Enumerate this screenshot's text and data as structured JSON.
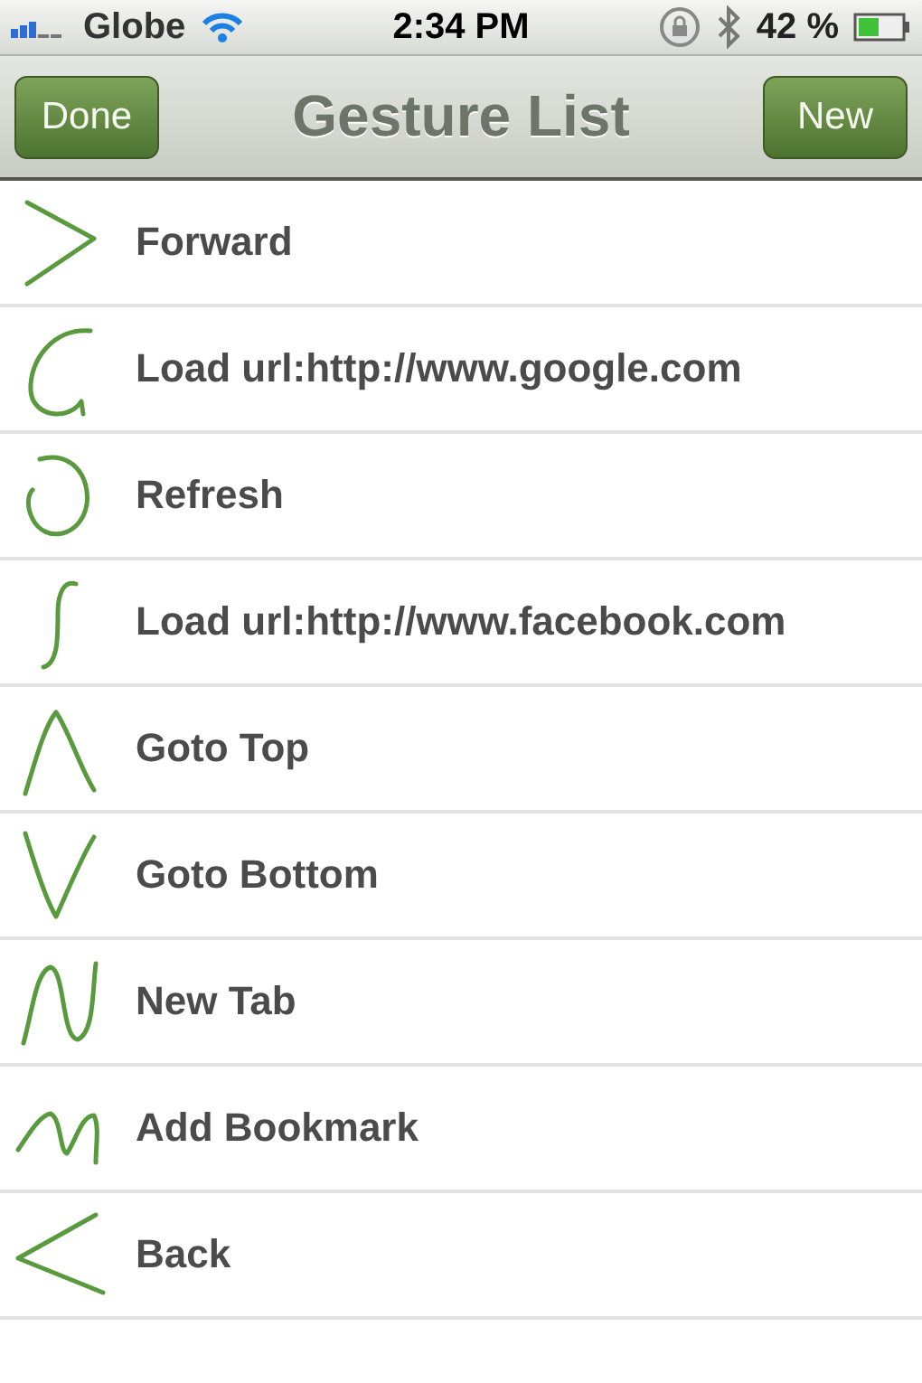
{
  "status_bar": {
    "carrier": "Globe",
    "time": "2:34 PM",
    "battery": "42 %"
  },
  "nav_bar": {
    "left_button": "Done",
    "title": "Gesture List",
    "right_button": "New"
  },
  "gestures": [
    {
      "kind": "right",
      "label": "Forward"
    },
    {
      "kind": "g",
      "label": "Load url:http://www.google.com"
    },
    {
      "kind": "circle",
      "label": "Refresh"
    },
    {
      "kind": "s",
      "label": "Load url:http://www.facebook.com"
    },
    {
      "kind": "up",
      "label": "Goto Top"
    },
    {
      "kind": "down",
      "label": "Goto Bottom"
    },
    {
      "kind": "n",
      "label": "New Tab"
    },
    {
      "kind": "m",
      "label": "Add Bookmark"
    },
    {
      "kind": "left",
      "label": "Back"
    }
  ]
}
